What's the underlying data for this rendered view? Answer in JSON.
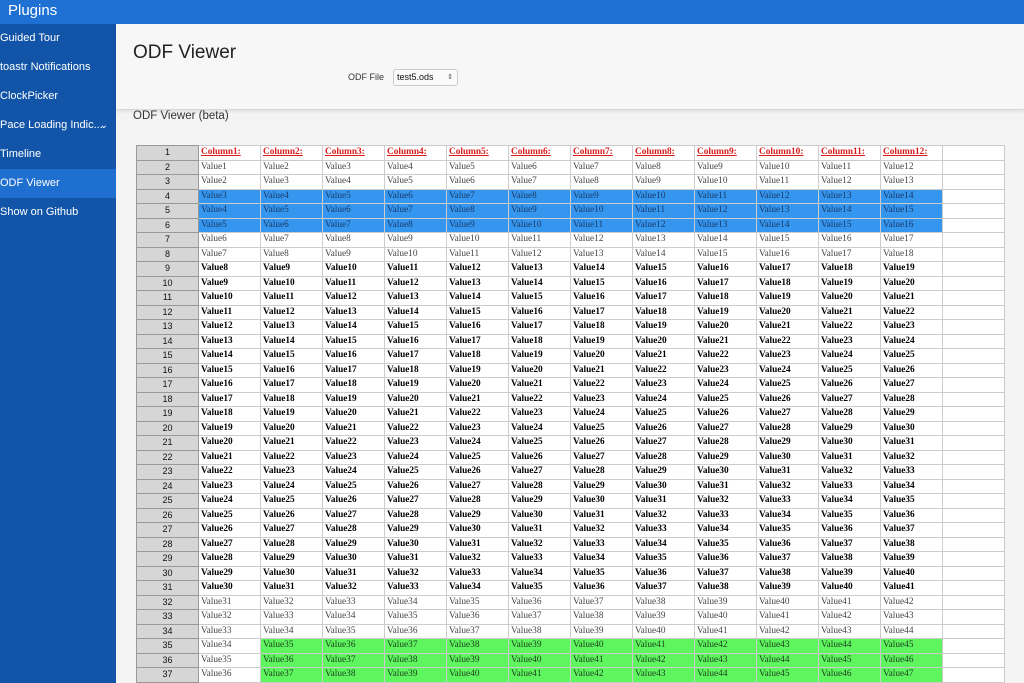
{
  "app": {
    "title": "Plugins"
  },
  "sidebar": {
    "items": [
      {
        "label": "Guided Tour"
      },
      {
        "label": "toastr Notifications"
      },
      {
        "label": "ClockPicker"
      },
      {
        "label": "Pace Loading Indic...",
        "has_chevron": true
      },
      {
        "label": "Timeline"
      },
      {
        "label": "ODF Viewer",
        "active": true
      },
      {
        "label": "Show on Github"
      }
    ]
  },
  "page": {
    "title": "ODF Viewer",
    "file_label": "ODF File",
    "file_value": "test5.ods",
    "viewer_title": "ODF Viewer (beta)"
  },
  "colors": {
    "topbar": "#1e70d2",
    "sidebar": "#1255a8",
    "highlight_blue": "#3596f0",
    "highlight_green": "#5ef55e",
    "header_red": "#d81b1b"
  },
  "sheet": {
    "header": [
      "Column1:",
      "Column2:",
      "Column3:",
      "Column4:",
      "Column5:",
      "Column6:",
      "Column7:",
      "Column8:",
      "Column9:",
      "Column10:",
      "Column11:",
      "Column12:"
    ],
    "rows": [
      {
        "n": "2",
        "style": "gray",
        "v": [
          "Value1",
          "Value2",
          "Value3",
          "Value4",
          "Value5",
          "Value6",
          "Value7",
          "Value8",
          "Value9",
          "Value10",
          "Value11",
          "Value12"
        ]
      },
      {
        "n": "3",
        "style": "gray",
        "v": [
          "Value2",
          "Value3",
          "Value4",
          "Value5",
          "Value6",
          "Value7",
          "Value8",
          "Value9",
          "Value10",
          "Value11",
          "Value12",
          "Value13"
        ]
      },
      {
        "n": "4",
        "style": "blue",
        "v": [
          "Value3",
          "Value4",
          "Value5",
          "Value6",
          "Value7",
          "Value8",
          "Value9",
          "Value10",
          "Value11",
          "Value12",
          "Value13",
          "Value14"
        ]
      },
      {
        "n": "5",
        "style": "blue",
        "v": [
          "Value4",
          "Value5",
          "Value6",
          "Value7",
          "Value8",
          "Value9",
          "Value10",
          "Value11",
          "Value12",
          "Value13",
          "Value14",
          "Value15"
        ]
      },
      {
        "n": "6",
        "style": "blue",
        "v": [
          "Value5",
          "Value6",
          "Value7",
          "Value8",
          "Value9",
          "Value10",
          "Value11",
          "Value12",
          "Value13",
          "Value14",
          "Value15",
          "Value16"
        ]
      },
      {
        "n": "7",
        "style": "gray",
        "v": [
          "Value6",
          "Value7",
          "Value8",
          "Value9",
          "Value10",
          "Value11",
          "Value12",
          "Value13",
          "Value14",
          "Value15",
          "Value16",
          "Value17"
        ]
      },
      {
        "n": "8",
        "style": "gray",
        "v": [
          "Value7",
          "Value8",
          "Value9",
          "Value10",
          "Value11",
          "Value12",
          "Value13",
          "Value14",
          "Value15",
          "Value16",
          "Value17",
          "Value18"
        ]
      },
      {
        "n": "9",
        "style": "bold",
        "v": [
          "Value8",
          "Value9",
          "Value10",
          "Value11",
          "Value12",
          "Value13",
          "Value14",
          "Value15",
          "Value16",
          "Value17",
          "Value18",
          "Value19"
        ]
      },
      {
        "n": "10",
        "style": "bold",
        "v": [
          "Value9",
          "Value10",
          "Value11",
          "Value12",
          "Value13",
          "Value14",
          "Value15",
          "Value16",
          "Value17",
          "Value18",
          "Value19",
          "Value20"
        ]
      },
      {
        "n": "11",
        "style": "bold",
        "v": [
          "Value10",
          "Value11",
          "Value12",
          "Value13",
          "Value14",
          "Value15",
          "Value16",
          "Value17",
          "Value18",
          "Value19",
          "Value20",
          "Value21"
        ]
      },
      {
        "n": "12",
        "style": "bold",
        "v": [
          "Value11",
          "Value12",
          "Value13",
          "Value14",
          "Value15",
          "Value16",
          "Value17",
          "Value18",
          "Value19",
          "Value20",
          "Value21",
          "Value22"
        ]
      },
      {
        "n": "13",
        "style": "bold",
        "v": [
          "Value12",
          "Value13",
          "Value14",
          "Value15",
          "Value16",
          "Value17",
          "Value18",
          "Value19",
          "Value20",
          "Value21",
          "Value22",
          "Value23"
        ]
      },
      {
        "n": "14",
        "style": "bold",
        "v": [
          "Value13",
          "Value14",
          "Value15",
          "Value16",
          "Value17",
          "Value18",
          "Value19",
          "Value20",
          "Value21",
          "Value22",
          "Value23",
          "Value24"
        ]
      },
      {
        "n": "15",
        "style": "bold",
        "v": [
          "Value14",
          "Value15",
          "Value16",
          "Value17",
          "Value18",
          "Value19",
          "Value20",
          "Value21",
          "Value22",
          "Value23",
          "Value24",
          "Value25"
        ]
      },
      {
        "n": "16",
        "style": "bold",
        "v": [
          "Value15",
          "Value16",
          "Value17",
          "Value18",
          "Value19",
          "Value20",
          "Value21",
          "Value22",
          "Value23",
          "Value24",
          "Value25",
          "Value26"
        ]
      },
      {
        "n": "17",
        "style": "bold",
        "v": [
          "Value16",
          "Value17",
          "Value18",
          "Value19",
          "Value20",
          "Value21",
          "Value22",
          "Value23",
          "Value24",
          "Value25",
          "Value26",
          "Value27"
        ]
      },
      {
        "n": "18",
        "style": "bold",
        "v": [
          "Value17",
          "Value18",
          "Value19",
          "Value20",
          "Value21",
          "Value22",
          "Value23",
          "Value24",
          "Value25",
          "Value26",
          "Value27",
          "Value28"
        ]
      },
      {
        "n": "19",
        "style": "bold",
        "v": [
          "Value18",
          "Value19",
          "Value20",
          "Value21",
          "Value22",
          "Value23",
          "Value24",
          "Value25",
          "Value26",
          "Value27",
          "Value28",
          "Value29"
        ]
      },
      {
        "n": "20",
        "style": "bold",
        "v": [
          "Value19",
          "Value20",
          "Value21",
          "Value22",
          "Value23",
          "Value24",
          "Value25",
          "Value26",
          "Value27",
          "Value28",
          "Value29",
          "Value30"
        ]
      },
      {
        "n": "21",
        "style": "bold",
        "v": [
          "Value20",
          "Value21",
          "Value22",
          "Value23",
          "Value24",
          "Value25",
          "Value26",
          "Value27",
          "Value28",
          "Value29",
          "Value30",
          "Value31"
        ]
      },
      {
        "n": "22",
        "style": "bold",
        "v": [
          "Value21",
          "Value22",
          "Value23",
          "Value24",
          "Value25",
          "Value26",
          "Value27",
          "Value28",
          "Value29",
          "Value30",
          "Value31",
          "Value32"
        ]
      },
      {
        "n": "23",
        "style": "bold",
        "v": [
          "Value22",
          "Value23",
          "Value24",
          "Value25",
          "Value26",
          "Value27",
          "Value28",
          "Value29",
          "Value30",
          "Value31",
          "Value32",
          "Value33"
        ]
      },
      {
        "n": "24",
        "style": "bold",
        "v": [
          "Value23",
          "Value24",
          "Value25",
          "Value26",
          "Value27",
          "Value28",
          "Value29",
          "Value30",
          "Value31",
          "Value32",
          "Value33",
          "Value34"
        ]
      },
      {
        "n": "25",
        "style": "bold",
        "v": [
          "Value24",
          "Value25",
          "Value26",
          "Value27",
          "Value28",
          "Value29",
          "Value30",
          "Value31",
          "Value32",
          "Value33",
          "Value34",
          "Value35"
        ]
      },
      {
        "n": "26",
        "style": "bold",
        "v": [
          "Value25",
          "Value26",
          "Value27",
          "Value28",
          "Value29",
          "Value30",
          "Value31",
          "Value32",
          "Value33",
          "Value34",
          "Value35",
          "Value36"
        ]
      },
      {
        "n": "27",
        "style": "bold",
        "v": [
          "Value26",
          "Value27",
          "Value28",
          "Value29",
          "Value30",
          "Value31",
          "Value32",
          "Value33",
          "Value34",
          "Value35",
          "Value36",
          "Value37"
        ]
      },
      {
        "n": "28",
        "style": "bold",
        "v": [
          "Value27",
          "Value28",
          "Value29",
          "Value30",
          "Value31",
          "Value32",
          "Value33",
          "Value34",
          "Value35",
          "Value36",
          "Value37",
          "Value38"
        ]
      },
      {
        "n": "29",
        "style": "bold",
        "v": [
          "Value28",
          "Value29",
          "Value30",
          "Value31",
          "Value32",
          "Value33",
          "Value34",
          "Value35",
          "Value36",
          "Value37",
          "Value38",
          "Value39"
        ]
      },
      {
        "n": "30",
        "style": "bold",
        "v": [
          "Value29",
          "Value30",
          "Value31",
          "Value32",
          "Value33",
          "Value34",
          "Value35",
          "Value36",
          "Value37",
          "Value38",
          "Value39",
          "Value40"
        ]
      },
      {
        "n": "31",
        "style": "bold",
        "v": [
          "Value30",
          "Value31",
          "Value32",
          "Value33",
          "Value34",
          "Value35",
          "Value36",
          "Value37",
          "Value38",
          "Value39",
          "Value40",
          "Value41"
        ]
      },
      {
        "n": "32",
        "style": "gray",
        "v": [
          "Value31",
          "Value32",
          "Value33",
          "Value34",
          "Value35",
          "Value36",
          "Value37",
          "Value38",
          "Value39",
          "Value40",
          "Value41",
          "Value42"
        ]
      },
      {
        "n": "33",
        "style": "gray",
        "v": [
          "Value32",
          "Value33",
          "Value34",
          "Value35",
          "Value36",
          "Value37",
          "Value38",
          "Value39",
          "Value40",
          "Value41",
          "Value42",
          "Value43"
        ]
      },
      {
        "n": "34",
        "style": "gray",
        "v": [
          "Value33",
          "Value34",
          "Value35",
          "Value36",
          "Value37",
          "Value38",
          "Value39",
          "Value40",
          "Value41",
          "Value42",
          "Value43",
          "Value44"
        ]
      },
      {
        "n": "35",
        "style": "green",
        "v": [
          "Value34",
          "Value35",
          "Value36",
          "Value37",
          "Value38",
          "Value39",
          "Value40",
          "Value41",
          "Value42",
          "Value43",
          "Value44",
          "Value45"
        ]
      },
      {
        "n": "36",
        "style": "green",
        "v": [
          "Value35",
          "Value36",
          "Value37",
          "Value38",
          "Value39",
          "Value40",
          "Value41",
          "Value42",
          "Value43",
          "Value44",
          "Value45",
          "Value46"
        ]
      },
      {
        "n": "37",
        "style": "green",
        "v": [
          "Value36",
          "Value37",
          "Value38",
          "Value39",
          "Value40",
          "Value41",
          "Value42",
          "Value43",
          "Value44",
          "Value45",
          "Value46",
          "Value47"
        ]
      }
    ]
  }
}
